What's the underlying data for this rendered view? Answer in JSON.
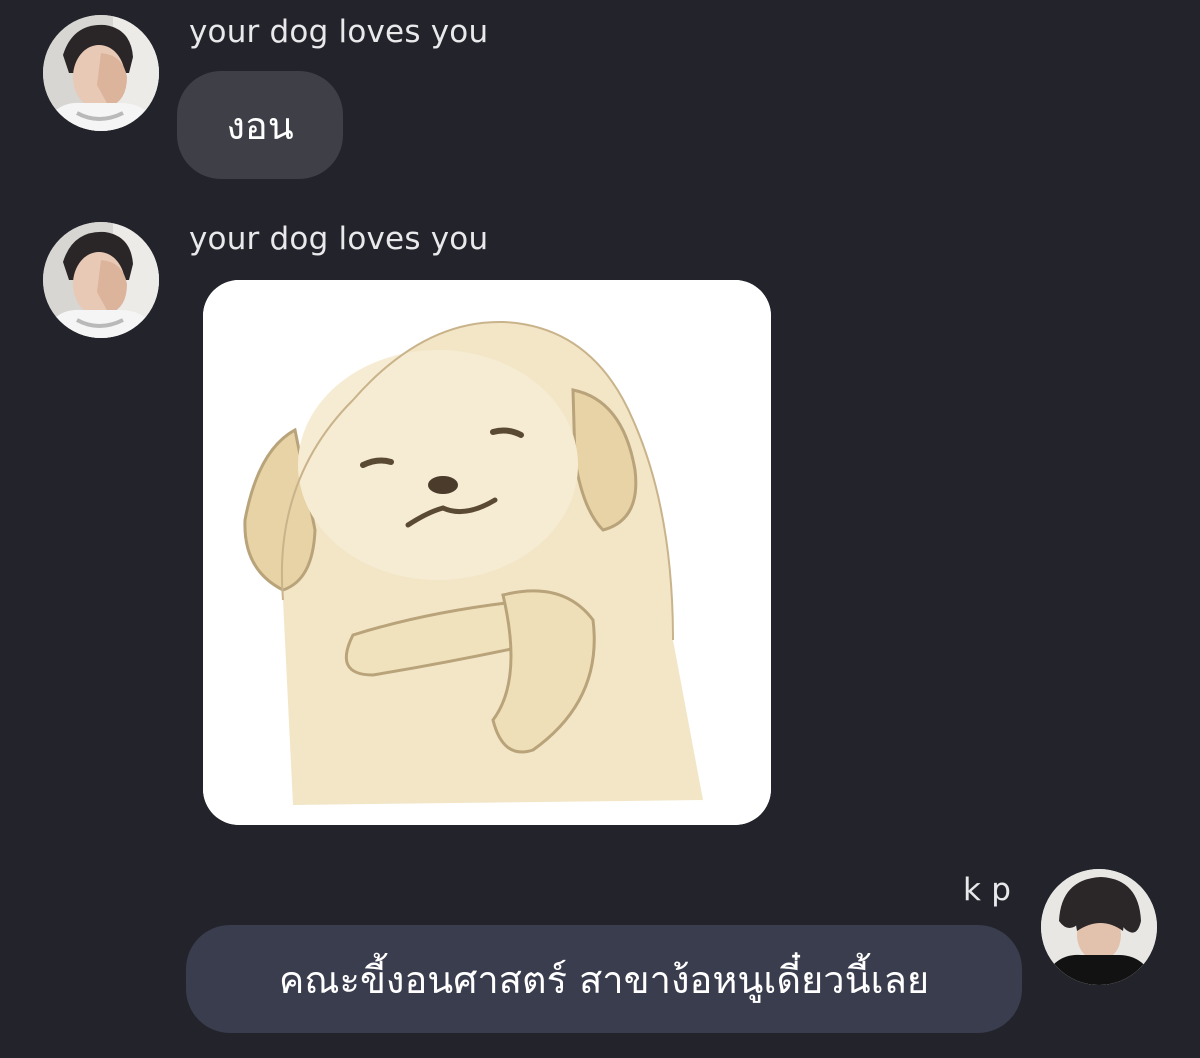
{
  "messages": [
    {
      "sender": "your dog loves you",
      "type": "text",
      "text": "งอน",
      "avatar_icon": "user-avatar-icon"
    },
    {
      "sender": "your dog loves you",
      "type": "sticker",
      "sticker_icon": "puppy-arms-crossed-sticker",
      "avatar_icon": "user-avatar-icon"
    },
    {
      "sender": "k p",
      "type": "text",
      "text": "คณะขี้งอนศาสตร์ สาขาง้อหนูเดี๋ยวนี้เลย",
      "avatar_icon": "user-avatar-icon"
    }
  ],
  "colors": {
    "background": "#23242b",
    "incoming_bubble": "#3f4047",
    "outgoing_bubble": "#3a3d4e",
    "text": "#ffffff"
  }
}
